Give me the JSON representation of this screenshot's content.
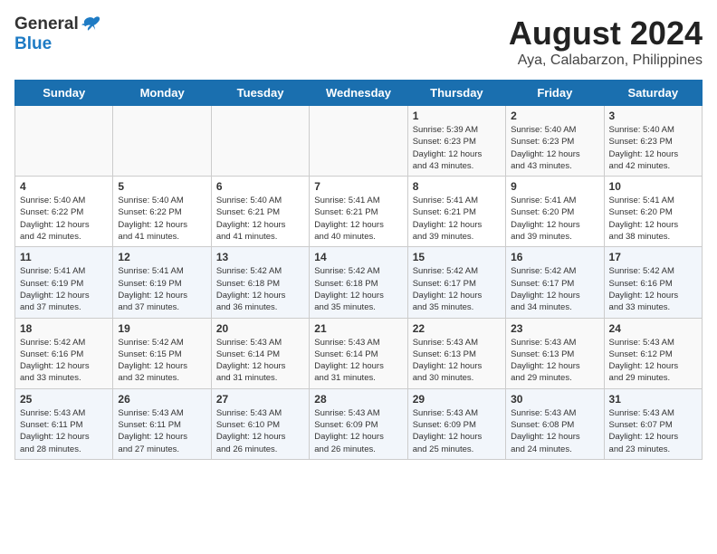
{
  "header": {
    "logo_general": "General",
    "logo_blue": "Blue",
    "month_title": "August 2024",
    "location": "Aya, Calabarzon, Philippines"
  },
  "weekdays": [
    "Sunday",
    "Monday",
    "Tuesday",
    "Wednesday",
    "Thursday",
    "Friday",
    "Saturday"
  ],
  "weeks": [
    [
      {
        "day": "",
        "info": ""
      },
      {
        "day": "",
        "info": ""
      },
      {
        "day": "",
        "info": ""
      },
      {
        "day": "",
        "info": ""
      },
      {
        "day": "1",
        "info": "Sunrise: 5:39 AM\nSunset: 6:23 PM\nDaylight: 12 hours\nand 43 minutes."
      },
      {
        "day": "2",
        "info": "Sunrise: 5:40 AM\nSunset: 6:23 PM\nDaylight: 12 hours\nand 43 minutes."
      },
      {
        "day": "3",
        "info": "Sunrise: 5:40 AM\nSunset: 6:23 PM\nDaylight: 12 hours\nand 42 minutes."
      }
    ],
    [
      {
        "day": "4",
        "info": "Sunrise: 5:40 AM\nSunset: 6:22 PM\nDaylight: 12 hours\nand 42 minutes."
      },
      {
        "day": "5",
        "info": "Sunrise: 5:40 AM\nSunset: 6:22 PM\nDaylight: 12 hours\nand 41 minutes."
      },
      {
        "day": "6",
        "info": "Sunrise: 5:40 AM\nSunset: 6:21 PM\nDaylight: 12 hours\nand 41 minutes."
      },
      {
        "day": "7",
        "info": "Sunrise: 5:41 AM\nSunset: 6:21 PM\nDaylight: 12 hours\nand 40 minutes."
      },
      {
        "day": "8",
        "info": "Sunrise: 5:41 AM\nSunset: 6:21 PM\nDaylight: 12 hours\nand 39 minutes."
      },
      {
        "day": "9",
        "info": "Sunrise: 5:41 AM\nSunset: 6:20 PM\nDaylight: 12 hours\nand 39 minutes."
      },
      {
        "day": "10",
        "info": "Sunrise: 5:41 AM\nSunset: 6:20 PM\nDaylight: 12 hours\nand 38 minutes."
      }
    ],
    [
      {
        "day": "11",
        "info": "Sunrise: 5:41 AM\nSunset: 6:19 PM\nDaylight: 12 hours\nand 37 minutes."
      },
      {
        "day": "12",
        "info": "Sunrise: 5:41 AM\nSunset: 6:19 PM\nDaylight: 12 hours\nand 37 minutes."
      },
      {
        "day": "13",
        "info": "Sunrise: 5:42 AM\nSunset: 6:18 PM\nDaylight: 12 hours\nand 36 minutes."
      },
      {
        "day": "14",
        "info": "Sunrise: 5:42 AM\nSunset: 6:18 PM\nDaylight: 12 hours\nand 35 minutes."
      },
      {
        "day": "15",
        "info": "Sunrise: 5:42 AM\nSunset: 6:17 PM\nDaylight: 12 hours\nand 35 minutes."
      },
      {
        "day": "16",
        "info": "Sunrise: 5:42 AM\nSunset: 6:17 PM\nDaylight: 12 hours\nand 34 minutes."
      },
      {
        "day": "17",
        "info": "Sunrise: 5:42 AM\nSunset: 6:16 PM\nDaylight: 12 hours\nand 33 minutes."
      }
    ],
    [
      {
        "day": "18",
        "info": "Sunrise: 5:42 AM\nSunset: 6:16 PM\nDaylight: 12 hours\nand 33 minutes."
      },
      {
        "day": "19",
        "info": "Sunrise: 5:42 AM\nSunset: 6:15 PM\nDaylight: 12 hours\nand 32 minutes."
      },
      {
        "day": "20",
        "info": "Sunrise: 5:43 AM\nSunset: 6:14 PM\nDaylight: 12 hours\nand 31 minutes."
      },
      {
        "day": "21",
        "info": "Sunrise: 5:43 AM\nSunset: 6:14 PM\nDaylight: 12 hours\nand 31 minutes."
      },
      {
        "day": "22",
        "info": "Sunrise: 5:43 AM\nSunset: 6:13 PM\nDaylight: 12 hours\nand 30 minutes."
      },
      {
        "day": "23",
        "info": "Sunrise: 5:43 AM\nSunset: 6:13 PM\nDaylight: 12 hours\nand 29 minutes."
      },
      {
        "day": "24",
        "info": "Sunrise: 5:43 AM\nSunset: 6:12 PM\nDaylight: 12 hours\nand 29 minutes."
      }
    ],
    [
      {
        "day": "25",
        "info": "Sunrise: 5:43 AM\nSunset: 6:11 PM\nDaylight: 12 hours\nand 28 minutes."
      },
      {
        "day": "26",
        "info": "Sunrise: 5:43 AM\nSunset: 6:11 PM\nDaylight: 12 hours\nand 27 minutes."
      },
      {
        "day": "27",
        "info": "Sunrise: 5:43 AM\nSunset: 6:10 PM\nDaylight: 12 hours\nand 26 minutes."
      },
      {
        "day": "28",
        "info": "Sunrise: 5:43 AM\nSunset: 6:09 PM\nDaylight: 12 hours\nand 26 minutes."
      },
      {
        "day": "29",
        "info": "Sunrise: 5:43 AM\nSunset: 6:09 PM\nDaylight: 12 hours\nand 25 minutes."
      },
      {
        "day": "30",
        "info": "Sunrise: 5:43 AM\nSunset: 6:08 PM\nDaylight: 12 hours\nand 24 minutes."
      },
      {
        "day": "31",
        "info": "Sunrise: 5:43 AM\nSunset: 6:07 PM\nDaylight: 12 hours\nand 23 minutes."
      }
    ]
  ]
}
